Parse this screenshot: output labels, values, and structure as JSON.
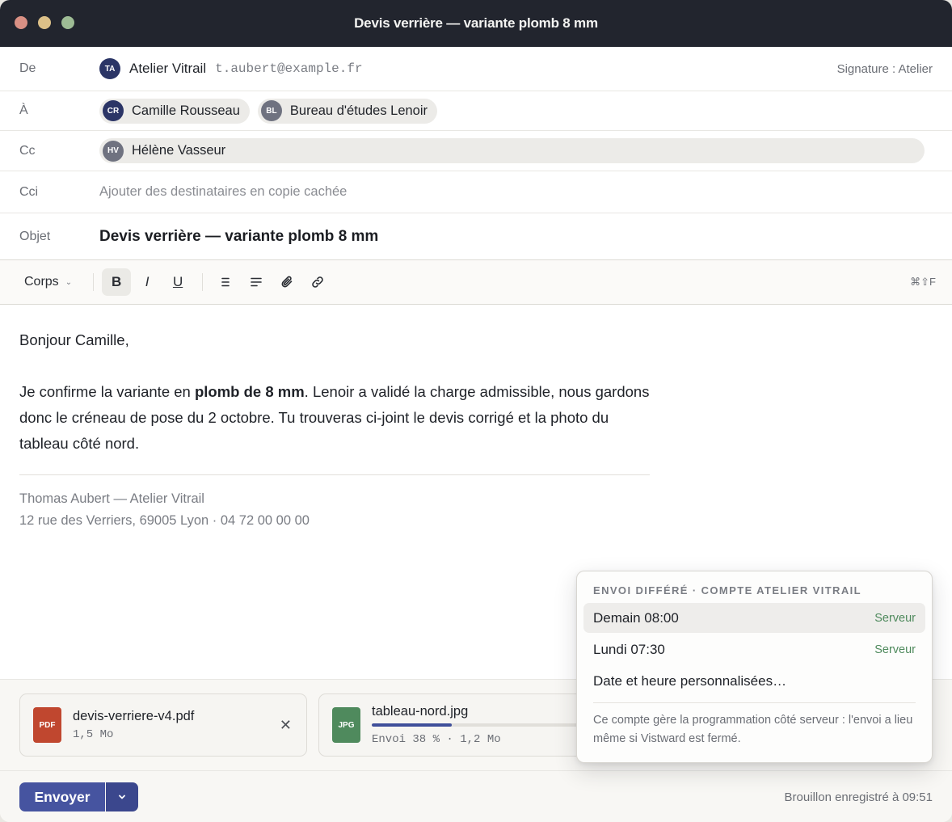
{
  "window": {
    "title": "Devis verrière — variante plomb 8 mm"
  },
  "from": {
    "label": "De",
    "initials": "TA",
    "name": "Atelier Vitrail",
    "email": "t.aubert@example.fr",
    "signature": "Signature : Atelier"
  },
  "to": {
    "label": "À",
    "recipients": [
      {
        "initials": "CR",
        "name": "Camille Rousseau"
      },
      {
        "initials": "BL",
        "name": "Bureau d'études Lenoir"
      }
    ]
  },
  "cc": {
    "label": "Cc",
    "recipients": [
      {
        "initials": "HV",
        "name": "Hélène Vasseur"
      }
    ]
  },
  "bcc": {
    "label": "Cci",
    "placeholder": "Ajouter des destinataires en copie cachée"
  },
  "subject": {
    "label": "Objet",
    "value": "Devis verrière — variante plomb 8 mm"
  },
  "toolbar": {
    "style": "Corps",
    "bold": "B",
    "italic": "I",
    "underline": "U",
    "shortcut": "⌘⇧F"
  },
  "body": {
    "greeting": "Bonjour Camille,",
    "p1_before": "Je confirme la variante en ",
    "p1_bold": "plomb de 8 mm",
    "p1_after": ". Lenoir a validé la charge admissible, nous gardons donc le créneau de pose du 2 octobre. Tu trouveras ci-joint le devis corrigé et la photo du tableau côté nord.",
    "sig_line1": "Thomas Aubert — Atelier Vitrail",
    "sig_line2": "12 rue des Verriers, 69005 Lyon · 04 72 00 00 00"
  },
  "attachments": [
    {
      "type": "PDF",
      "name": "devis-verriere-v4.pdf",
      "meta": "1,5 Mo"
    },
    {
      "type": "JPG",
      "name": "tableau-nord.jpg",
      "meta": "Envoi 38 % · 1,2 Mo",
      "progress": 0.38
    }
  ],
  "footer": {
    "send": "Envoyer",
    "saved": "Brouillon enregistré à 09:51"
  },
  "schedule": {
    "heading": "Envoi différé · compte Atelier Vitrail",
    "options": [
      {
        "label": "Demain 08:00",
        "tag": "Serveur",
        "selected": true
      },
      {
        "label": "Lundi 07:30",
        "tag": "Serveur"
      },
      {
        "label": "Date et heure personnalisées…"
      }
    ],
    "note": "Ce compte gère la programmation côté serveur : l'envoi a lieu même si Vistward est fermé."
  },
  "colors": {
    "accent": "#4654a0",
    "titlebar": "#22252e",
    "pdf": "#c0472f",
    "jpg": "#4f8a5d",
    "server_tag": "#4f8a5d"
  }
}
